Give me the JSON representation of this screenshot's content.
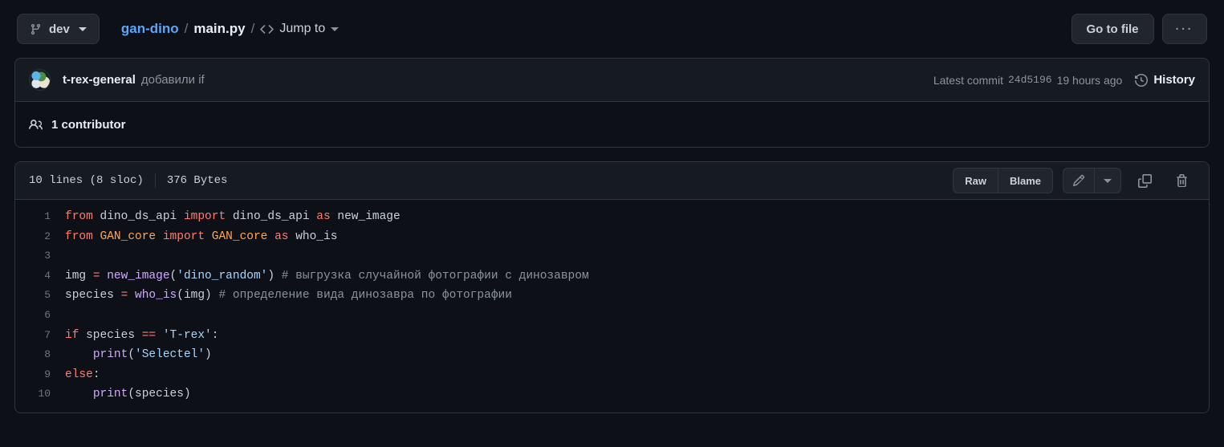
{
  "topbar": {
    "branch": {
      "label": "dev",
      "icon": "git-branch-icon"
    },
    "breadcrumb": {
      "repo": "gan-dino",
      "sep1": "/",
      "file": "main.py",
      "sep2": "/",
      "jump_to": "Jump to",
      "code_icon": "code-brackets-icon"
    },
    "go_to_file": "Go to file",
    "more": "···"
  },
  "commit": {
    "author": "t-rex-general",
    "message": "добавили if",
    "latest_label": "Latest commit",
    "sha": "24d5196",
    "time": "19 hours ago",
    "history": "History",
    "avatar_alt": "t-rex-general avatar"
  },
  "contributors": {
    "text": "1 contributor",
    "icon": "people-icon"
  },
  "file": {
    "lines_info": "10 lines (8 sloc)",
    "size": "376 Bytes",
    "raw": "Raw",
    "blame": "Blame",
    "edit_icon": "pencil-icon",
    "edit_caret_icon": "chevron-down-icon",
    "copy_icon": "copy-icon",
    "delete_icon": "trash-icon"
  },
  "colors": {
    "page_bg": "#0d1117",
    "panel_bg": "#161b22",
    "border": "#30363d",
    "text": "#c9d1d9",
    "muted": "#8b949e",
    "link": "#58a6ff",
    "keyword": "#ff7b72",
    "function": "#d2a8ff",
    "string": "#a5d6ff",
    "constant": "#ffa657",
    "comment": "#8b949e"
  },
  "code": {
    "language": "python",
    "lines": [
      {
        "n": "1",
        "tokens": [
          {
            "t": "from ",
            "c": "t-kw"
          },
          {
            "t": "dino_ds_api ",
            "c": "t-pl"
          },
          {
            "t": "import ",
            "c": "t-kw"
          },
          {
            "t": "dino_ds_api ",
            "c": "t-pl"
          },
          {
            "t": "as ",
            "c": "t-kw"
          },
          {
            "t": "new_image",
            "c": "t-pl"
          }
        ]
      },
      {
        "n": "2",
        "tokens": [
          {
            "t": "from ",
            "c": "t-kw"
          },
          {
            "t": "GAN_core ",
            "c": "t-const"
          },
          {
            "t": "import ",
            "c": "t-kw"
          },
          {
            "t": "GAN_core ",
            "c": "t-const"
          },
          {
            "t": "as ",
            "c": "t-kw"
          },
          {
            "t": "who_is",
            "c": "t-pl"
          }
        ]
      },
      {
        "n": "3",
        "tokens": [
          {
            "t": "",
            "c": "t-pl"
          }
        ]
      },
      {
        "n": "4",
        "tokens": [
          {
            "t": "img ",
            "c": "t-pl"
          },
          {
            "t": "= ",
            "c": "t-op"
          },
          {
            "t": "new_image",
            "c": "t-fn"
          },
          {
            "t": "(",
            "c": "t-pl"
          },
          {
            "t": "'dino_random'",
            "c": "t-str"
          },
          {
            "t": ") ",
            "c": "t-pl"
          },
          {
            "t": "# выгрузка случайной фотографии с динозавром",
            "c": "t-com"
          }
        ]
      },
      {
        "n": "5",
        "tokens": [
          {
            "t": "species ",
            "c": "t-pl"
          },
          {
            "t": "= ",
            "c": "t-op"
          },
          {
            "t": "who_is",
            "c": "t-fn"
          },
          {
            "t": "(img) ",
            "c": "t-pl"
          },
          {
            "t": "# определение вида динозавра по фотографии",
            "c": "t-com"
          }
        ]
      },
      {
        "n": "6",
        "tokens": [
          {
            "t": "",
            "c": "t-pl"
          }
        ]
      },
      {
        "n": "7",
        "tokens": [
          {
            "t": "if ",
            "c": "t-kw"
          },
          {
            "t": "species ",
            "c": "t-pl"
          },
          {
            "t": "== ",
            "c": "t-op"
          },
          {
            "t": "'T-rex'",
            "c": "t-str"
          },
          {
            "t": ":",
            "c": "t-pl"
          }
        ]
      },
      {
        "n": "8",
        "tokens": [
          {
            "t": "    ",
            "c": "t-pl"
          },
          {
            "t": "print",
            "c": "t-fn"
          },
          {
            "t": "(",
            "c": "t-pl"
          },
          {
            "t": "'Selectel'",
            "c": "t-str"
          },
          {
            "t": ")",
            "c": "t-pl"
          }
        ]
      },
      {
        "n": "9",
        "tokens": [
          {
            "t": "else",
            "c": "t-kw"
          },
          {
            "t": ":",
            "c": "t-pl"
          }
        ]
      },
      {
        "n": "10",
        "tokens": [
          {
            "t": "    ",
            "c": "t-pl"
          },
          {
            "t": "print",
            "c": "t-fn"
          },
          {
            "t": "(species)",
            "c": "t-pl"
          }
        ]
      }
    ]
  }
}
